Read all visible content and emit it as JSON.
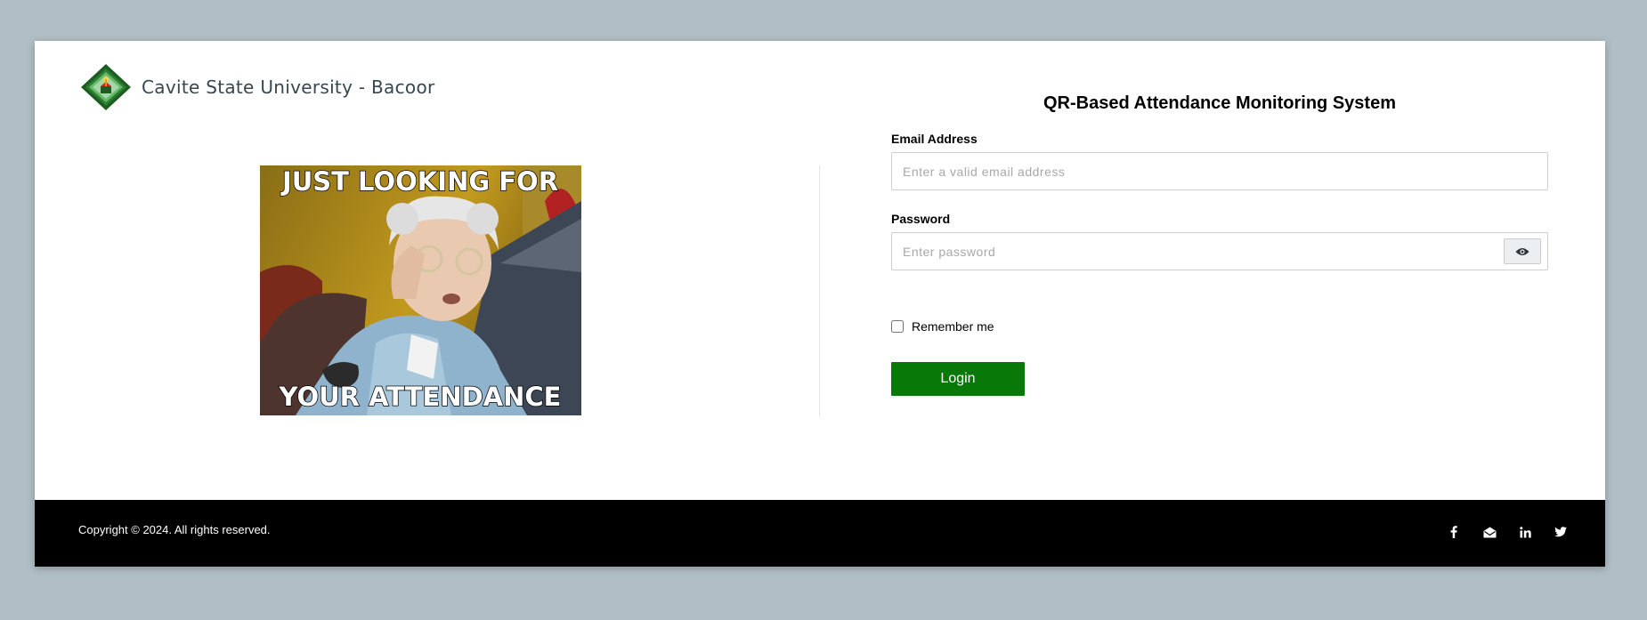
{
  "brand": {
    "name": "Cavite State University - Bacoor",
    "colors": {
      "diamond_dark": "#1b5e20",
      "diamond_light": "#66bb6a",
      "accent": "#ffd54f"
    }
  },
  "meme": {
    "top_text": "JUST LOOKING FOR",
    "bottom_text": "YOUR ATTENDANCE"
  },
  "form": {
    "title": "QR-Based Attendance Monitoring System",
    "email_label": "Email Address",
    "email_placeholder": "Enter a valid email address",
    "email_value": "",
    "password_label": "Password",
    "password_placeholder": "Enter password",
    "password_value": "",
    "toggle_icon": "eye-icon",
    "remember_label": "Remember me",
    "remember_checked": false,
    "login_label": "Login",
    "login_color": "#087809"
  },
  "footer": {
    "copyright": "Copyright © 2024. All rights reserved.",
    "social": [
      "facebook-icon",
      "mail-open-icon",
      "linkedin-icon",
      "twitter-icon"
    ]
  },
  "colors": {
    "page_bg": "#b0bec5",
    "card_bg": "#ffffff",
    "footer_bg": "#000000"
  }
}
